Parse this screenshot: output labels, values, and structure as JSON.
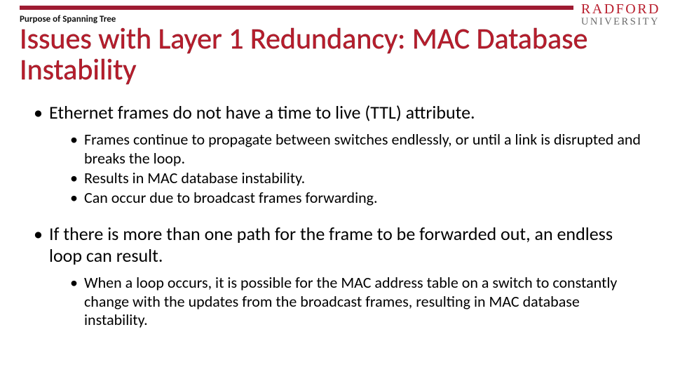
{
  "brand": {
    "top": "RADFORD",
    "bottom": "UNIVERSITY"
  },
  "kicker": "Purpose of Spanning Tree",
  "title": "Issues with Layer 1 Redundancy: MAC Database Instability",
  "bullets": [
    {
      "text": "Ethernet frames do not have a time to live (TTL) attribute.",
      "sub": [
        "Frames continue to propagate between switches endlessly, or until a link is disrupted and breaks the loop.",
        "Results in MAC database instability.",
        "Can occur due to broadcast frames forwarding."
      ]
    },
    {
      "text": "If there is more than one path for the frame to be forwarded out, an endless loop can result.",
      "sub": [
        "When a loop occurs, it is possible for the MAC address table on a switch to constantly change with the updates from the broadcast frames, resulting in MAC database instability."
      ]
    }
  ]
}
